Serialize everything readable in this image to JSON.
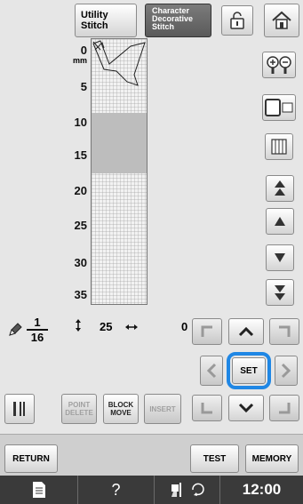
{
  "top": {
    "utility_tab": "Utility\nStitch",
    "character_tab": [
      "Character",
      "Decorative",
      "Stitch"
    ]
  },
  "ruler": {
    "unit": "mm",
    "ticks": [
      "0",
      "5",
      "10",
      "15",
      "20",
      "25",
      "30",
      "35"
    ]
  },
  "status": {
    "fraction_num": "1",
    "fraction_den": "16",
    "vertical_value": "25",
    "horizontal_value": "0"
  },
  "edit_buttons": {
    "point_delete": [
      "POINT",
      "DELETE"
    ],
    "block_move": [
      "BLOCK",
      "MOVE"
    ],
    "insert": "INSERT"
  },
  "nav": {
    "set": "SET"
  },
  "bottom": {
    "return": "RETURN",
    "test": "TEST",
    "memory": "MEMORY"
  },
  "footer": {
    "help": "?",
    "time": "12:00"
  }
}
